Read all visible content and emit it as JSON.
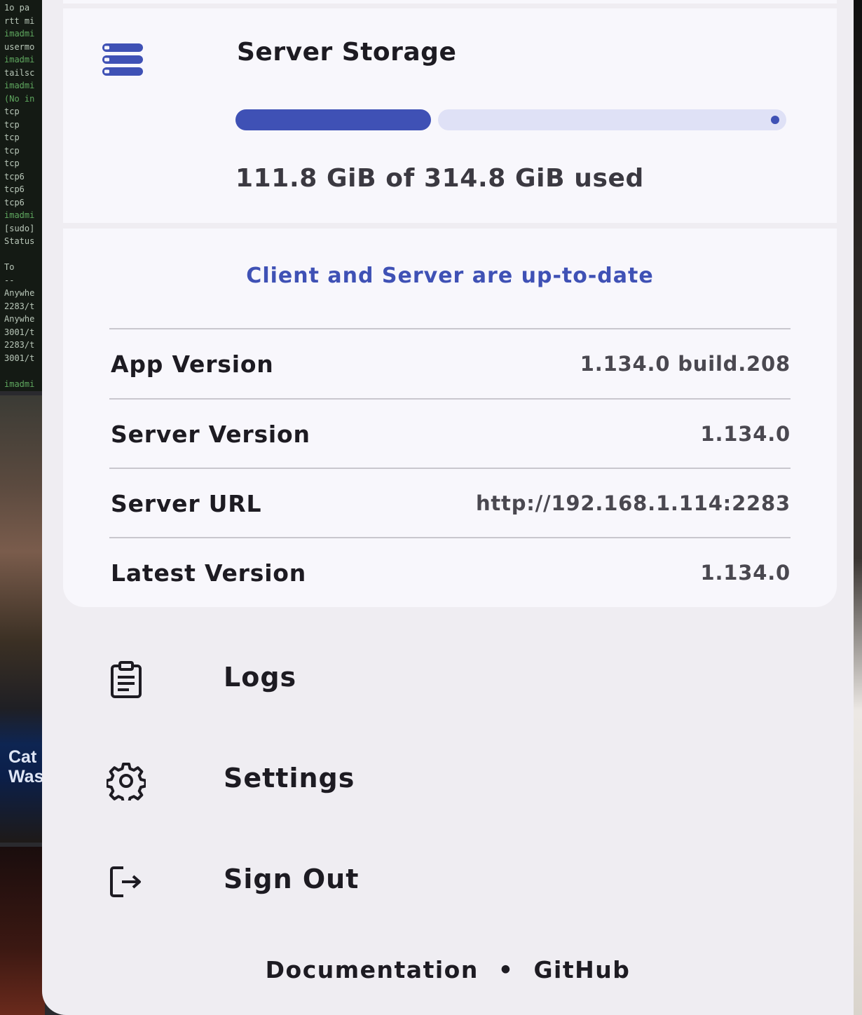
{
  "storage": {
    "title": "Server Storage",
    "usage_text": "111.8 GiB of 314.8 GiB used",
    "used_gib": 111.8,
    "total_gib": 314.8,
    "icon": "storage-stack-icon"
  },
  "status": {
    "message": "Client and Server are up-to-date"
  },
  "info": [
    {
      "label": "App Version",
      "value": "1.134.0 build.208"
    },
    {
      "label": "Server Version",
      "value": "1.134.0"
    },
    {
      "label": "Server URL",
      "value": "http://192.168.1.114:2283"
    },
    {
      "label": "Latest Version",
      "value": "1.134.0"
    }
  ],
  "menu": [
    {
      "label": "Logs",
      "icon": "clipboard-list-icon"
    },
    {
      "label": "Settings",
      "icon": "gear-icon"
    },
    {
      "label": "Sign Out",
      "icon": "logout-icon"
    }
  ],
  "footer": {
    "documentation": "Documentation",
    "separator": "•",
    "github": "GitHub"
  },
  "background": {
    "caption": "Cat\nWas"
  },
  "colors": {
    "accent": "#3f51b5",
    "track": "#dfe1f6",
    "sheet": "#efedf2",
    "card": "#f8f7fc"
  }
}
